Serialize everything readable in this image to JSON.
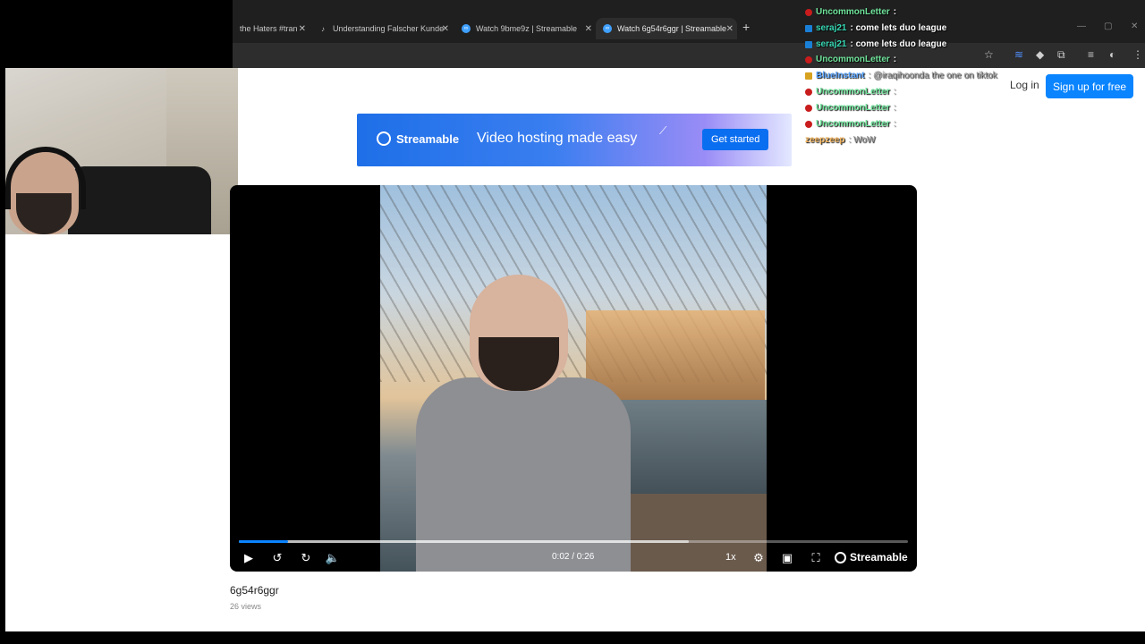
{
  "browser": {
    "tabs": [
      {
        "label": "the Haters #tran",
        "icon": "streamable-icon"
      },
      {
        "label": "Understanding Falscher Kunde",
        "icon": "tiktok-icon"
      },
      {
        "label": "Watch 9bme9z | Streamable",
        "icon": "streamable-icon"
      },
      {
        "label": "Watch 6g54r6ggr | Streamable",
        "icon": "streamable-icon"
      }
    ]
  },
  "header": {
    "login": "Log in",
    "signup": "Sign up for free"
  },
  "banner": {
    "brand": "Streamable",
    "tagline": "Video hosting made easy",
    "cta": "Get started"
  },
  "chat": [
    {
      "name": "UncommonLetter",
      "msg": ":",
      "badge": "red",
      "color": "green",
      "faded": false
    },
    {
      "name": "seraj21",
      "msg": ": come lets duo league",
      "badge": "blue",
      "color": "teal",
      "faded": false
    },
    {
      "name": "seraj21",
      "msg": ": come lets duo league",
      "badge": "blue",
      "color": "teal",
      "faded": false
    },
    {
      "name": "UncommonLetter",
      "msg": ":",
      "badge": "red",
      "color": "green",
      "faded": false
    },
    {
      "name": "BlueInstant",
      "msg": ": @iraqihoonda the one on tiktok",
      "badge": "gold",
      "color": "blue",
      "faded": true
    },
    {
      "name": "UncommonLetter",
      "msg": ":",
      "badge": "red",
      "color": "green",
      "faded": true
    },
    {
      "name": "UncommonLetter",
      "msg": ":",
      "badge": "red",
      "color": "green",
      "faded": true
    },
    {
      "name": "UncommonLetter",
      "msg": ":",
      "badge": "red",
      "color": "green",
      "faded": true
    },
    {
      "name": "zeepzeep",
      "msg": ": WoW",
      "badge": "",
      "color": "orange",
      "faded": true
    }
  ],
  "player": {
    "time": "0:02 / 0:26",
    "speed": "1x",
    "brand": "Streamable",
    "progress": 0.074,
    "buffered": 0.672
  },
  "video": {
    "title": "6g54r6ggr",
    "views": "26 views"
  },
  "colors": {
    "accent": "#0a84ff",
    "chrome": "#1f1f1f"
  }
}
